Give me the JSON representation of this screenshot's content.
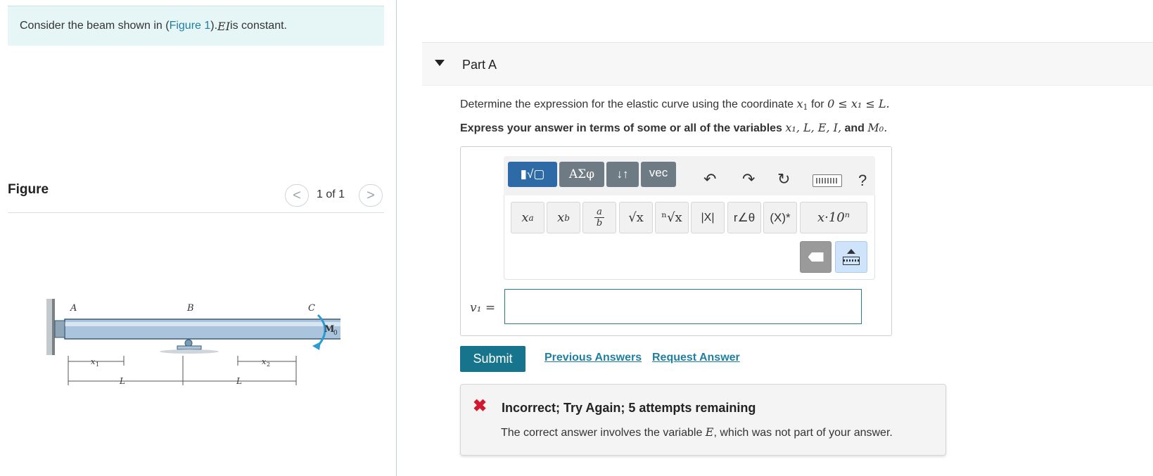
{
  "intro": {
    "text_before": "Consider the beam shown in (",
    "figure_link": "Figure 1",
    "text_mid": "). ",
    "ei": "EI",
    "text_after": " is constant."
  },
  "figure": {
    "title": "Figure",
    "pager": "1 of 1",
    "prev_glyph": "<",
    "next_glyph": ">",
    "labels": {
      "a": "A",
      "b": "B",
      "c": "C",
      "moment": "M",
      "moment_sub": "0",
      "x1": "x",
      "x1_sub": "1",
      "x2": "x",
      "x2_sub": "2",
      "span1": "L",
      "span2": "L"
    }
  },
  "part": {
    "title": "Part A",
    "question_before": "Determine the expression for the elastic curve using the coordinate ",
    "question_var": "x",
    "question_var_sub": "1",
    "question_for": " for ",
    "question_range": "0 ≤ x₁ ≤ L.",
    "instruction_before": "Express your answer in terms of some or all of the variables ",
    "instruction_vars": "x₁, L, E, I,",
    "instruction_and": " and ",
    "instruction_last": "M₀."
  },
  "toolbar": {
    "templates_label": "▮√▢",
    "greek_label": "ΑΣφ",
    "arrows_label": "↓↑",
    "vec_label": "vec",
    "undo_icon": "↶",
    "redo_icon": "↷",
    "reset_icon": "↻",
    "help_label": "?",
    "sup_label": "x",
    "sup_exp": "a",
    "sub_label": "x",
    "sub_idx": "b",
    "frac_top": "a",
    "frac_bot": "b",
    "sqrt_label": "√x",
    "nroot_label": "ⁿ√x",
    "abs_label": "|X|",
    "polar_label": "r∠θ",
    "conj_label": "(X)*",
    "sci_label": "x·10ⁿ"
  },
  "answer": {
    "label": "v₁ =",
    "value": ""
  },
  "actions": {
    "submit": "Submit",
    "previous_answers": "Previous Answers",
    "request_answer": "Request Answer"
  },
  "feedback": {
    "icon": "✖",
    "title": "Incorrect; Try Again; 5 attempts remaining",
    "text_before": "The correct answer involves the variable ",
    "variable": "E",
    "text_after": ", which was not part of your answer."
  },
  "colors": {
    "accent": "#16748d",
    "link": "#1f7fa0",
    "error": "#d3172e",
    "intro_bg": "#e6f5f6",
    "toolbar_active": "#2d6aa6"
  }
}
